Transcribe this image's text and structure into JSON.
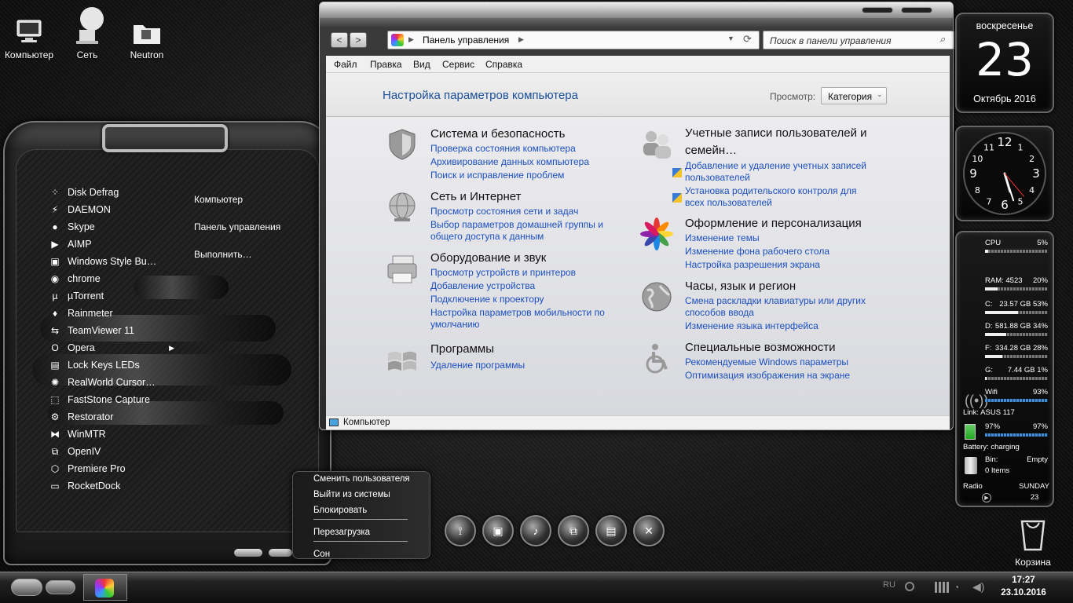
{
  "desktop": {
    "icons": [
      {
        "label": "Компьютер",
        "icon": "computer-icon"
      },
      {
        "label": "Сеть",
        "icon": "network-icon"
      },
      {
        "label": "Neutron",
        "icon": "folder-icon"
      }
    ],
    "recycle_bin": "Корзина"
  },
  "start_menu": {
    "programs": [
      {
        "label": "Disk Defrag",
        "icon": "defrag-icon"
      },
      {
        "label": "DAEMON",
        "icon": "lightning-icon"
      },
      {
        "label": "Skype",
        "icon": "skype-icon"
      },
      {
        "label": "AIMP",
        "icon": "play-icon"
      },
      {
        "label": "Windows Style Bu…",
        "icon": "windows-icon"
      },
      {
        "label": "chrome",
        "icon": "chrome-icon"
      },
      {
        "label": "µTorrent",
        "icon": "utorrent-icon"
      },
      {
        "label": "Rainmeter",
        "icon": "drop-icon"
      },
      {
        "label": "TeamViewer 11",
        "icon": "teamviewer-icon"
      },
      {
        "label": "Opera",
        "icon": "opera-icon"
      },
      {
        "label": "Lock Keys LEDs",
        "icon": "keys-icon"
      },
      {
        "label": "RealWorld Cursor…",
        "icon": "cursor-icon"
      },
      {
        "label": "FastStone Capture",
        "icon": "capture-icon"
      },
      {
        "label": "Restorator",
        "icon": "gear-icon"
      },
      {
        "label": "WinMTR",
        "icon": "network-trace-icon"
      },
      {
        "label": "OpenIV",
        "icon": "openiv-icon"
      },
      {
        "label": "Premiere Pro",
        "icon": "premiere-icon"
      },
      {
        "label": "RocketDock",
        "icon": "dock-icon"
      }
    ],
    "right_links": [
      "Компьютер",
      "Панель управления",
      "Выполнить…"
    ]
  },
  "power_menu": {
    "items": [
      "Сменить пользователя",
      "Выйти из системы",
      "Блокировать",
      "Перезагрузка",
      "Сон"
    ]
  },
  "window": {
    "address": "Панель управления",
    "search_placeholder": "Поиск в панели управления",
    "menu": [
      "Файл",
      "Правка",
      "Вид",
      "Сервис",
      "Справка"
    ],
    "heading": "Настройка параметров компьютера",
    "view_label": "Просмотр:",
    "view_value": "Категория",
    "status": "Компьютер",
    "categories_left": [
      {
        "title": "Система и безопасность",
        "icon": "shield-icon",
        "links": [
          "Проверка состояния компьютера",
          "Архивирование данных компьютера",
          "Поиск и исправление проблем"
        ]
      },
      {
        "title": "Сеть и Интернет",
        "icon": "globe-icon",
        "links": [
          "Просмотр состояния сети и задач",
          "Выбор параметров домашней группы и общего доступа к данным"
        ]
      },
      {
        "title": "Оборудование и звук",
        "icon": "printer-icon",
        "links": [
          "Просмотр устройств и принтеров",
          "Добавление устройства",
          "Подключение к проектору",
          "Настройка параметров мобильности по умолчанию"
        ]
      },
      {
        "title": "Программы",
        "icon": "programs-icon",
        "links": [
          "Удаление программы"
        ]
      }
    ],
    "categories_right": [
      {
        "title": "Учетные записи пользователей и семейн…",
        "icon": "users-icon",
        "links": [
          "Добавление и удаление учетных записей пользователей",
          "Установка родительского контроля для всех пользователей"
        ]
      },
      {
        "title": "Оформление и персонализация",
        "icon": "palette-icon",
        "links": [
          "Изменение темы",
          "Изменение фона рабочего стола",
          "Настройка разрешения экрана"
        ]
      },
      {
        "title": "Часы, язык и регион",
        "icon": "clock-globe-icon",
        "links": [
          "Смена раскладки клавиатуры или других способов ввода",
          "Изменение языка интерфейса"
        ]
      },
      {
        "title": "Специальные возможности",
        "icon": "accessibility-icon",
        "links": [
          "Рекомендуемые Windows параметры",
          "Оптимизация изображения на экране"
        ]
      }
    ]
  },
  "calendar": {
    "weekday": "воскресенье",
    "day": "23",
    "month_year": "Октябрь 2016"
  },
  "clock": {
    "numbers": [
      "12",
      "1",
      "2",
      "3",
      "4",
      "5",
      "6",
      "7",
      "8",
      "9",
      "10",
      "11"
    ],
    "hour": 17,
    "minute": 27
  },
  "sysmon": {
    "cpu_label": "CPU",
    "cpu_value": "5%",
    "cpu_fraction": 0.05,
    "ram_label": "RAM: 4523",
    "ram_value": "20%",
    "ram_fraction": 0.2,
    "drives": [
      {
        "label": "C:",
        "size": "23.57 GB",
        "pct": "53%",
        "fraction": 0.53
      },
      {
        "label": "D:",
        "size": "581.88 GB",
        "pct": "34%",
        "fraction": 0.34
      },
      {
        "label": "F:",
        "size": "334.28 GB",
        "pct": "28%",
        "fraction": 0.28
      },
      {
        "label": "G:",
        "size": "7.44 GB",
        "pct": "1%",
        "fraction": 0.01
      }
    ],
    "wifi_label": "Wifi",
    "wifi_value": "93%",
    "wifi_fraction": 0.93,
    "link": "Link: ASUS 117",
    "battery_left": "97%",
    "battery_right": "97%",
    "battery_fraction": 0.97,
    "battery_status": "Battery: charging",
    "bin_label": "Bin:",
    "bin_state": "Empty",
    "bin_items": "0 Items",
    "radio_label": "Radio",
    "radio_day": "SUNDAY",
    "radio_date": "23"
  },
  "taskbar": {
    "lang": "RU",
    "time": "17:27",
    "date": "23.10.2016"
  }
}
